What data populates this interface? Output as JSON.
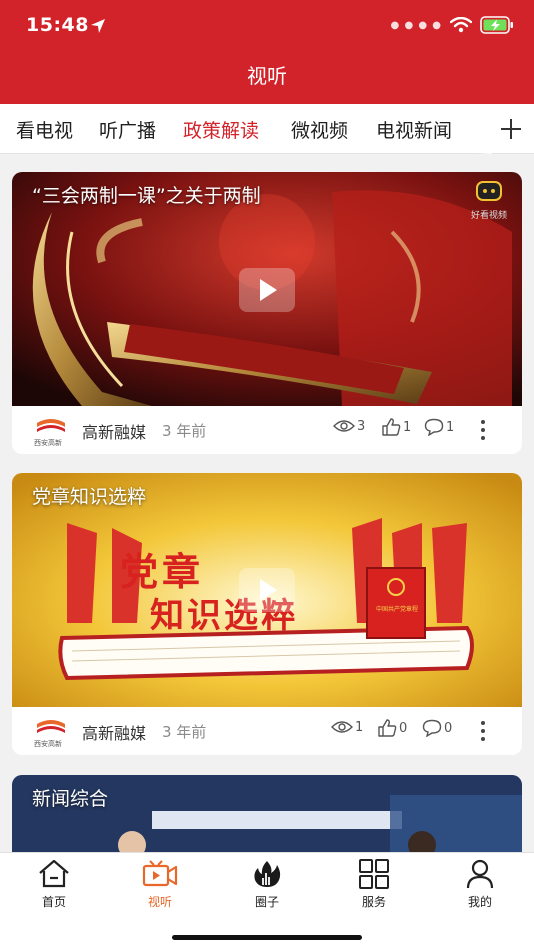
{
  "status_bar": {
    "time": "15:48"
  },
  "header": {
    "title": "视听"
  },
  "tabs": [
    {
      "label": "看电视",
      "active": false
    },
    {
      "label": "听广播",
      "active": false
    },
    {
      "label": "政策解读",
      "active": true
    },
    {
      "label": "微视频",
      "active": false
    },
    {
      "label": "电视新闻",
      "active": false
    }
  ],
  "feed": [
    {
      "title": "“三会两制一课”之关于两制",
      "watermark": "好看视频",
      "source": "高新融媒",
      "logo_text": "西安高新",
      "time": "3 年前",
      "views": "3",
      "likes": "1",
      "comments": "1"
    },
    {
      "title": "党章知识选粹",
      "art_line1": "党章",
      "art_line2": "知识选粹",
      "book_label": "中国共产党章程",
      "source": "高新融媒",
      "logo_text": "西安高新",
      "time": "3 年前",
      "views": "1",
      "likes": "0",
      "comments": "0"
    },
    {
      "title": "新闻综合"
    }
  ],
  "bottom_nav": [
    {
      "label": "首页",
      "icon": "home-icon",
      "active": false
    },
    {
      "label": "视听",
      "icon": "video-icon",
      "active": true
    },
    {
      "label": "圈子",
      "icon": "flame-icon",
      "active": false
    },
    {
      "label": "服务",
      "icon": "grid-icon",
      "active": false
    },
    {
      "label": "我的",
      "icon": "user-icon",
      "active": false
    }
  ],
  "colors": {
    "brand_red": "#d2232a",
    "active_tab": "#d2232a",
    "active_nav": "#e8672a"
  }
}
